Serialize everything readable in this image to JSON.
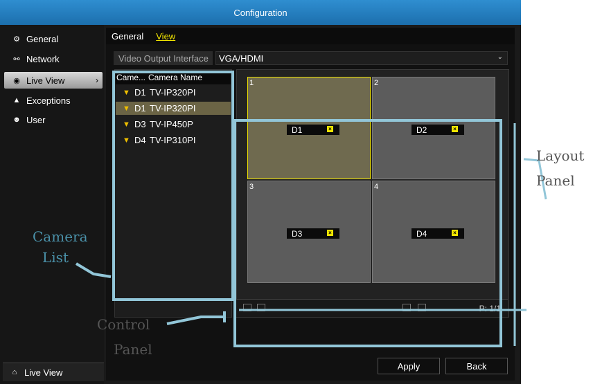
{
  "window": {
    "title": "Configuration"
  },
  "sidebar": {
    "items": [
      {
        "label": "General",
        "icon": "gear-icon"
      },
      {
        "label": "Network",
        "icon": "network-icon"
      },
      {
        "label": "Live View",
        "icon": "eye-icon",
        "active": true
      },
      {
        "label": "Exceptions",
        "icon": "warning-icon"
      },
      {
        "label": "User",
        "icon": "users-icon"
      }
    ],
    "bottom": {
      "label": "Live View",
      "icon": "home-icon"
    }
  },
  "tabs": [
    {
      "label": "General"
    },
    {
      "label": "View",
      "active": true
    }
  ],
  "video_output": {
    "label": "Video Output Interface",
    "value": "VGA/HDMI"
  },
  "camera_list": {
    "headers": [
      "Came...",
      "Camera Name"
    ],
    "rows": [
      {
        "id": "D1",
        "name": "TV-IP320PI"
      },
      {
        "id": "D1",
        "name": "TV-IP320PI",
        "selected": true
      },
      {
        "id": "D3",
        "name": "TV-IP450P"
      },
      {
        "id": "D4",
        "name": "TV-IP310PI"
      }
    ]
  },
  "layout": {
    "tiles": [
      {
        "num": "1",
        "tag": "D1",
        "selected": true
      },
      {
        "num": "2",
        "tag": "D2"
      },
      {
        "num": "3",
        "tag": "D3"
      },
      {
        "num": "4",
        "tag": "D4"
      }
    ]
  },
  "control": {
    "page": "P: 1/1"
  },
  "buttons": {
    "apply": "Apply",
    "back": "Back"
  },
  "callouts": {
    "camera_list": [
      "Camera",
      "List"
    ],
    "control_panel": [
      "Control",
      "Panel"
    ],
    "layout_panel": [
      "Layout",
      "Panel"
    ]
  },
  "colors": {
    "accent_blue": "#1c6fad",
    "selected_yellow": "#f2e600",
    "callout_line": "#92c6d8"
  }
}
